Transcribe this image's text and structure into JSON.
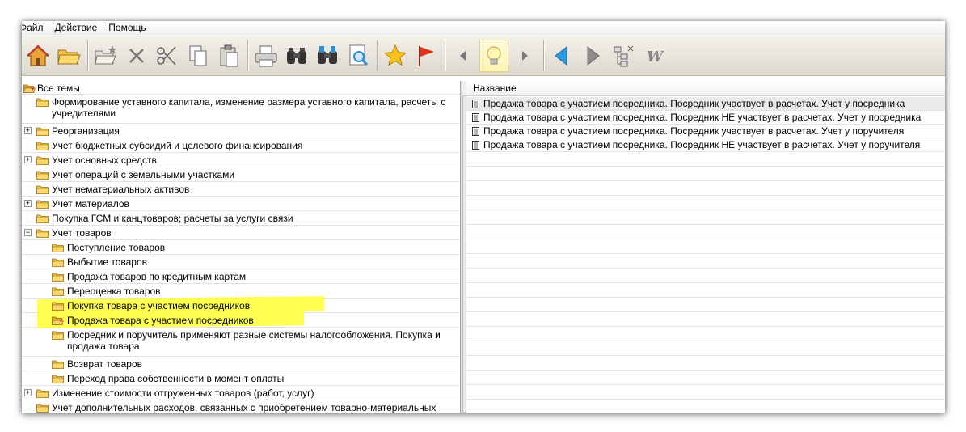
{
  "menu": [
    "Файл",
    "Действие",
    "Помощь"
  ],
  "toolbar": {
    "buttons": [
      "home-icon",
      "open-folder-icon",
      "new-folder-icon",
      "delete-icon",
      "scissors-icon",
      "copy-icon",
      "paste-icon",
      "print-icon",
      "binoculars-icon",
      "binoculars-advanced-icon",
      "preview-icon",
      "star-icon",
      "flag-icon",
      "arrow-left-small-icon",
      "lightbulb-icon",
      "arrow-right-small-icon",
      "back-arrow-icon",
      "forward-arrow-icon",
      "tree-sync-icon",
      "word-icon"
    ],
    "word_glyph": "W"
  },
  "tree": {
    "root": "Все темы",
    "items": [
      {
        "label": "Формирование уставного капитала, изменение размера уставного капитала, расчеты с",
        "label2": "учредителями"
      },
      {
        "label": "Реорганизация",
        "expander": "+"
      },
      {
        "label": "Учет бюджетных субсидий и целевого финансирования"
      },
      {
        "label": "Учет основных средств",
        "expander": "+"
      },
      {
        "label": "Учет операций с земельными участками"
      },
      {
        "label": "Учет нематериальных активов"
      },
      {
        "label": "Учет материалов",
        "expander": "+"
      },
      {
        "label": "Покупка ГСМ и канцтоваров; расчеты за услуги связи"
      },
      {
        "label": "Учет товаров",
        "expander": "−"
      },
      {
        "label": "Поступление товаров",
        "child": true
      },
      {
        "label": "Выбытие товаров",
        "child": true
      },
      {
        "label": "Продажа товаров по кредитным картам",
        "child": true
      },
      {
        "label": "Переоценка товаров",
        "child": true
      },
      {
        "label": "Покупка товара с участием посредников",
        "child": true,
        "highlight": true
      },
      {
        "label": "Продажа товара с участием посредников",
        "child": true,
        "highlight": true,
        "open": true
      },
      {
        "label": "Посредник и поручитель применяют разные системы налогообложения. Покупка и",
        "label2": "продажа товара",
        "child": true
      },
      {
        "label": "Возврат товаров",
        "child": true
      },
      {
        "label": "Переход права собственности в момент оплаты",
        "child": true
      },
      {
        "label": "Изменение стоимости отгруженных товаров (работ, услуг)",
        "expander": "+"
      },
      {
        "label": "Учет дополнительных расходов, связанных с приобретением товарно-материальных"
      }
    ]
  },
  "list": {
    "column": "Название",
    "rows": [
      "Продажа товара с участием посредника. Посредник участвует в расчетах. Учет у посредника",
      "Продажа товара с участием посредника. Посредник НЕ участвует в расчетах. Учет у посредника",
      "Продажа товара с участием посредника. Посредник участвует в расчетах. Учет у поручителя",
      "Продажа товара с участием посредника. Посредник НЕ участвует в расчетах. Учет у поручителя"
    ]
  },
  "colors": {
    "highlight": "#ffff33",
    "folder": "#f2c14a",
    "toolbar": "#e8e3da"
  }
}
